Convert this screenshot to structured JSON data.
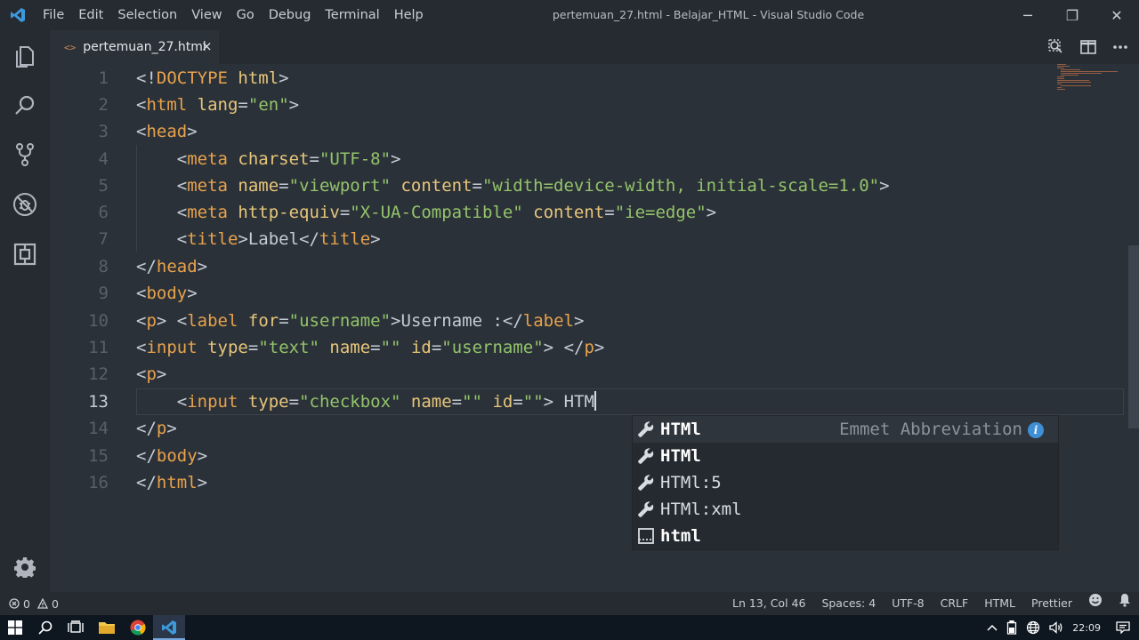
{
  "window": {
    "title": "pertemuan_27.html - Belajar_HTML - Visual Studio Code",
    "controls": [
      "─",
      "❐",
      "✕"
    ]
  },
  "menu": [
    "File",
    "Edit",
    "Selection",
    "View",
    "Go",
    "Debug",
    "Terminal",
    "Help"
  ],
  "tab": {
    "icon": "<>",
    "label": "pertemuan_27.html",
    "close": "×"
  },
  "editor": {
    "current_line": 13,
    "lines": [
      {
        "n": "1"
      },
      {
        "n": "2"
      },
      {
        "n": "3"
      },
      {
        "n": "4"
      },
      {
        "n": "5"
      },
      {
        "n": "6"
      },
      {
        "n": "7"
      },
      {
        "n": "8"
      },
      {
        "n": "9"
      },
      {
        "n": "10"
      },
      {
        "n": "11"
      },
      {
        "n": "12"
      },
      {
        "n": "13"
      },
      {
        "n": "14"
      },
      {
        "n": "15"
      },
      {
        "n": "16"
      }
    ],
    "code": {
      "l1": [
        "<!",
        "DOCTYPE",
        " html",
        ">"
      ],
      "l2": [
        "<",
        "html",
        " lang",
        "=",
        "\"en\"",
        ">"
      ],
      "l3": [
        "<",
        "head",
        ">"
      ],
      "l4": [
        "    <",
        "meta",
        " charset",
        "=",
        "\"UTF-8\"",
        ">"
      ],
      "l5": [
        "    <",
        "meta",
        " name",
        "=",
        "\"viewport\"",
        " content",
        "=",
        "\"width=device-width, initial-scale=1.0\"",
        ">"
      ],
      "l6": [
        "    <",
        "meta",
        " http-equiv",
        "=",
        "\"X-UA-Compatible\"",
        " content",
        "=",
        "\"ie=edge\"",
        ">"
      ],
      "l7": [
        "    <",
        "title",
        ">",
        "Label",
        "</",
        "title",
        ">"
      ],
      "l8": [
        "</",
        "head",
        ">"
      ],
      "l9": [
        "<",
        "body",
        ">"
      ],
      "l10": [
        "<",
        "p",
        "> <",
        "label",
        " for",
        "=",
        "\"username\"",
        ">",
        "Username :",
        "</",
        "label",
        ">"
      ],
      "l11": [
        "<",
        "input",
        " type",
        "=",
        "\"text\"",
        " name",
        "=",
        "\"\"",
        " id",
        "=",
        "\"username\"",
        ">",
        " </",
        "p",
        ">"
      ],
      "l12": [
        "<",
        "p",
        ">"
      ],
      "l13": [
        "    <",
        "input",
        " type",
        "=",
        "\"checkbox\"",
        " name",
        "=",
        "\"\"",
        " id",
        "=",
        "\"\"",
        ">",
        " HTM"
      ],
      "l14": [
        "</",
        "p",
        ">"
      ],
      "l15": [
        "</",
        "body",
        ">"
      ],
      "l16": [
        "</",
        "html",
        ">"
      ]
    }
  },
  "suggest": {
    "detail": "Emmet Abbreviation",
    "items": [
      {
        "label": "HTMl",
        "icon": "wrench-icon",
        "selected": true
      },
      {
        "label": "HTMl",
        "icon": "wrench-icon",
        "selected": false
      },
      {
        "label": "HTMl:5",
        "icon": "wrench-icon",
        "selected": false
      },
      {
        "label": "HTMl:xml",
        "icon": "wrench-icon",
        "selected": false
      },
      {
        "label": "html",
        "icon": "snippet-icon",
        "selected": false
      }
    ]
  },
  "status": {
    "errors": "0",
    "warnings": "0",
    "position": "Ln 13, Col 46",
    "spaces": "Spaces: 4",
    "encoding": "UTF-8",
    "eol": "CRLF",
    "language": "HTML",
    "formatter": "Prettier"
  },
  "taskbar": {
    "time": "22:09"
  },
  "colors": {
    "tag": "#e8a24c",
    "attribute": "#e7c67a",
    "string": "#93c46b",
    "punctuation": "#c5ccd6",
    "background": "#2b3138"
  }
}
